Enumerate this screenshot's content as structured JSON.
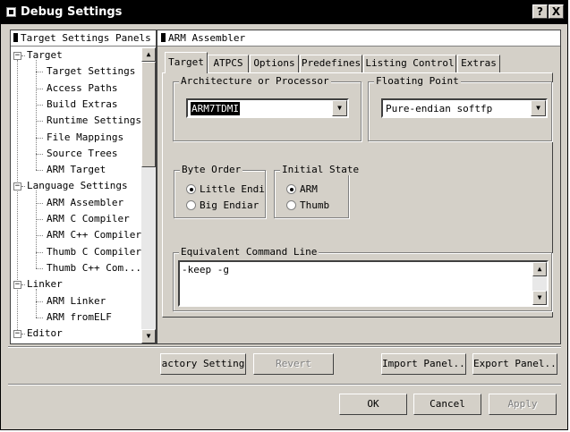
{
  "window": {
    "title": "Debug Settings",
    "help_label": "?",
    "close_label": "X"
  },
  "left_panel": {
    "header": "Target Settings Panels",
    "tree": [
      {
        "label": "Target",
        "level": 0,
        "expander": "−"
      },
      {
        "label": "Target Settings",
        "level": 1
      },
      {
        "label": "Access Paths",
        "level": 1
      },
      {
        "label": "Build Extras",
        "level": 1
      },
      {
        "label": "Runtime Settings",
        "level": 1
      },
      {
        "label": "File Mappings",
        "level": 1
      },
      {
        "label": "Source Trees",
        "level": 1
      },
      {
        "label": "ARM Target",
        "level": 1
      },
      {
        "label": "Language Settings",
        "level": 0,
        "expander": "−"
      },
      {
        "label": "ARM Assembler",
        "level": 1
      },
      {
        "label": "ARM C Compiler",
        "level": 1
      },
      {
        "label": "ARM C++ Compiler",
        "level": 1
      },
      {
        "label": "Thumb C Compiler",
        "level": 1
      },
      {
        "label": "Thumb C++ Com...",
        "level": 1
      },
      {
        "label": "Linker",
        "level": 0,
        "expander": "−"
      },
      {
        "label": "ARM Linker",
        "level": 1
      },
      {
        "label": "ARM fromELF",
        "level": 1
      },
      {
        "label": "Editor",
        "level": 0,
        "expander": "−"
      }
    ]
  },
  "right_panel": {
    "header": "ARM Assembler",
    "tabs": [
      {
        "label": "Target",
        "active": true
      },
      {
        "label": "ATPCS"
      },
      {
        "label": "Options"
      },
      {
        "label": "Predefines"
      },
      {
        "label": "Listing Control"
      },
      {
        "label": "Extras"
      }
    ],
    "architecture": {
      "label": "Architecture or Processor",
      "value": "ARM7TDMI"
    },
    "floating_point": {
      "label": "Floating Point",
      "value": "Pure-endian softfp"
    },
    "byte_order": {
      "label": "Byte Order",
      "options": [
        "Little Endi",
        "Big Endiar"
      ],
      "selected": 0
    },
    "initial_state": {
      "label": "Initial State",
      "options": [
        "ARM",
        "Thumb"
      ],
      "selected": 0
    },
    "command_line": {
      "label": "Equivalent Command Line",
      "value": "-keep -g"
    }
  },
  "buttons": {
    "factory": "actory Setting",
    "revert": "Revert",
    "import": "Import Panel...",
    "export": "Export Panel...",
    "ok": "OK",
    "cancel": "Cancel",
    "apply": "Apply"
  }
}
